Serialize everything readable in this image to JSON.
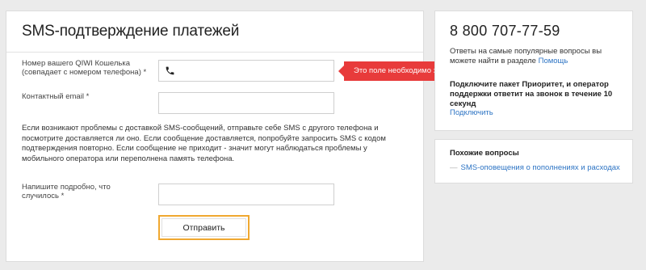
{
  "main": {
    "title": "SMS-подтверждение платежей",
    "wallet_label_line1": "Номер вашего QIWI Кошелька",
    "wallet_label_line2": "(совпадает с номером телефона) *",
    "wallet_value": "",
    "error_message": "Это поле необходимо заполнить",
    "email_label": "Контактный email *",
    "email_value": "",
    "help_text": "Если возникают проблемы с доставкой SMS-сообщений, отправьте себе SMS с другого телефона и посмотрите доставляется ли оно. Если сообщение доставляется, попробуйте запросить SMS с кодом подтверждения повторно. Если сообщение не приходит - значит могут наблюдаться проблемы у мобильного оператора или переполнена память телефона.",
    "details_label_line1": "Напишите подробно, что",
    "details_label_line2": "случилось *",
    "details_value": "",
    "submit_label": "Отправить",
    "submit_border_color": "#f0a830",
    "error_color": "#e83b3b"
  },
  "contact": {
    "phone": "8 800 707-77-59",
    "faq_text": "Ответы на самые популярные вопросы вы можете найти в разделе",
    "help_link": "Помощь",
    "priority_text": "Подключите пакет Приоритет, и оператор поддержки ответит на звонок в течение 10 секунд",
    "connect_link": "Подключить",
    "link_color": "#2d74c4"
  },
  "related": {
    "title": "Похожие вопросы",
    "items": [
      {
        "label": "SMS-оповещения о пополнениях и расходах"
      }
    ]
  },
  "icons": {
    "wallet_field_icon": "phone-icon"
  }
}
